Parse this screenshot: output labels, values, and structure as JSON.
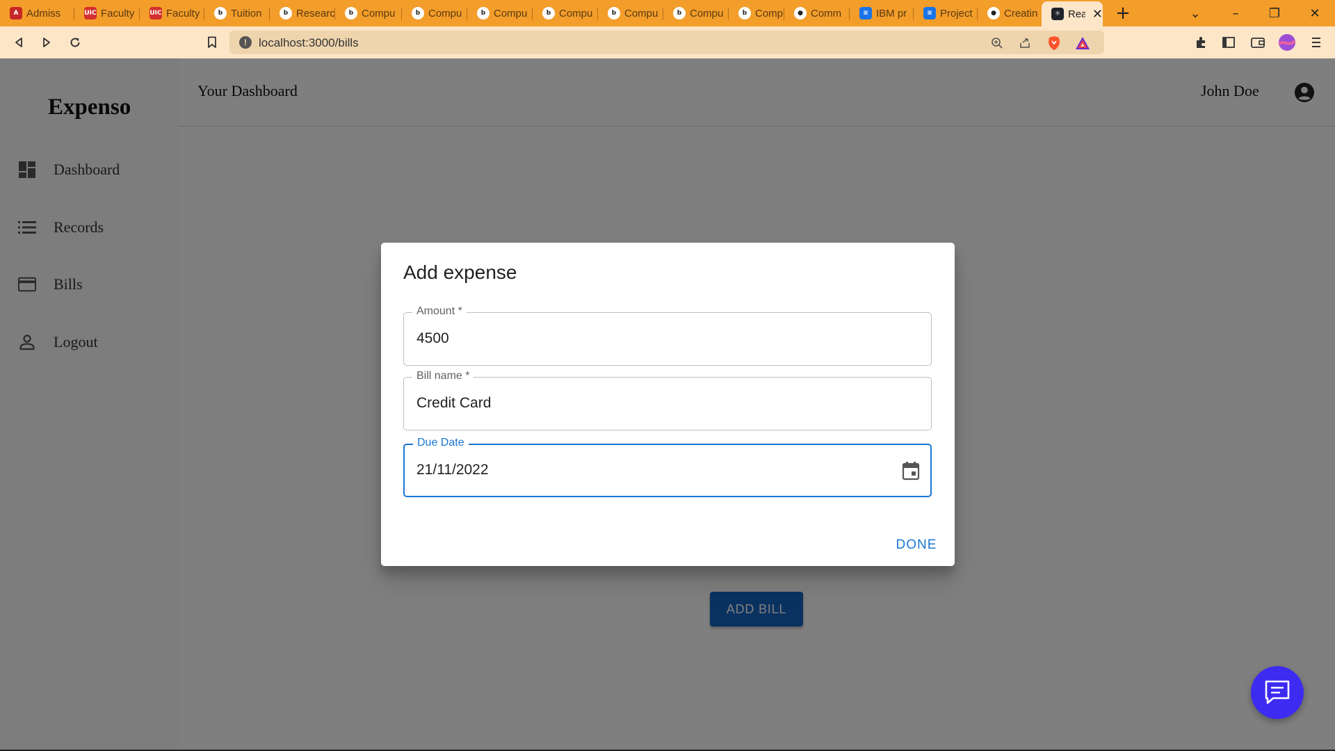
{
  "browser": {
    "tabs": [
      {
        "title": "Admiss",
        "icon": "admissions-icon",
        "color": "#c62828",
        "glyph": "A"
      },
      {
        "title": "Faculty",
        "icon": "uic-icon",
        "color": "#d32f2f",
        "glyph": "UIC"
      },
      {
        "title": "Faculty",
        "icon": "uic-icon",
        "color": "#d32f2f",
        "glyph": "UIC"
      },
      {
        "title": "Tuition",
        "icon": "tab-b-icon",
        "color": "#ffffff",
        "glyph": "b"
      },
      {
        "title": "Researc",
        "icon": "tab-b-icon",
        "color": "#ffffff",
        "glyph": "b"
      },
      {
        "title": "Compu",
        "icon": "tab-b-icon",
        "color": "#ffffff",
        "glyph": "b"
      },
      {
        "title": "Compu",
        "icon": "tab-b-icon",
        "color": "#ffffff",
        "glyph": "b"
      },
      {
        "title": "Compu",
        "icon": "tab-b-icon",
        "color": "#ffffff",
        "glyph": "b"
      },
      {
        "title": "Compu",
        "icon": "tab-b-icon",
        "color": "#ffffff",
        "glyph": "b"
      },
      {
        "title": "Compu",
        "icon": "tab-b-icon",
        "color": "#ffffff",
        "glyph": "b"
      },
      {
        "title": "Compu",
        "icon": "tab-b-icon",
        "color": "#ffffff",
        "glyph": "b"
      },
      {
        "title": "Compu",
        "icon": "tab-b-icon",
        "color": "#ffffff",
        "glyph": "b"
      },
      {
        "title": "Comm",
        "icon": "github-icon",
        "color": "#ffffff",
        "glyph": "●"
      },
      {
        "title": "IBM pr",
        "icon": "docs-icon",
        "color": "#1a73e8",
        "glyph": "≡"
      },
      {
        "title": "Project",
        "icon": "docs-icon",
        "color": "#1a73e8",
        "glyph": "≡"
      },
      {
        "title": "Creatin",
        "icon": "github-icon",
        "color": "#ffffff",
        "glyph": "●"
      },
      {
        "title": "Rea",
        "icon": "react-icon",
        "color": "#20232a",
        "glyph": "⚛",
        "active": true
      }
    ],
    "url": "localhost:3000/bills"
  },
  "app": {
    "brand": "Expenso",
    "nav": [
      {
        "label": "Dashboard",
        "icon": "dashboard-icon"
      },
      {
        "label": "Records",
        "icon": "list-icon"
      },
      {
        "label": "Bills",
        "icon": "credit-card-icon"
      },
      {
        "label": "Logout",
        "icon": "person-icon"
      }
    ],
    "page_title": "Your Dashboard",
    "user_name": "John Doe",
    "add_bill_label": "ADD BILL"
  },
  "dialog": {
    "title": "Add expense",
    "fields": [
      {
        "label": "Amount *",
        "value": "4500"
      },
      {
        "label": "Bill name *",
        "value": "Credit Card"
      },
      {
        "label": "Due Date",
        "value": "21/11/2022"
      }
    ],
    "done_label": "DONE"
  },
  "colors": {
    "accent": "#1976d2",
    "add_bill_button": "#1565c0",
    "chat_fab": "#3d2bf2",
    "tab_bar": "#f39d2a"
  }
}
